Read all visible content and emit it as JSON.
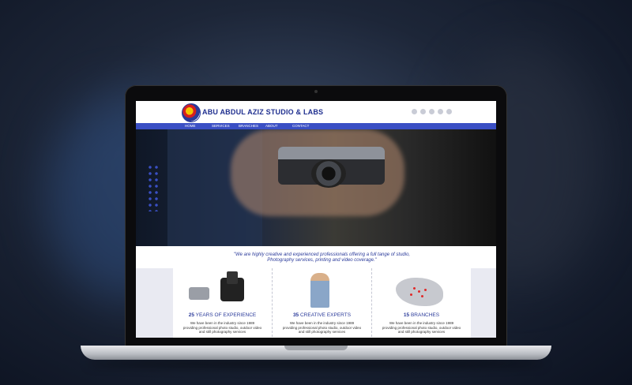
{
  "site": {
    "brand": "ABU ABDUL AZIZ STUDIO & LABS",
    "nav": [
      "HOME",
      "SERVICES",
      "BRANCHES",
      "ABOUT",
      "CONTACT"
    ],
    "quote": "\"We are highly creative and experienced professionals offering a full tange of studio, Photography services, printing and video coverage.\"",
    "features": [
      {
        "num": "25",
        "label": "YEARS OF EXPERIENCE",
        "desc": "We have been in the industry since 1989 providing professional photo studio, outdoor video and still photography services"
      },
      {
        "num": "35",
        "label": "CREATIVE EXPERTS",
        "desc": "We have been in the industry since 1989 providing professional photo studio, outdoor video and still photography services"
      },
      {
        "num": "15",
        "label": "BRANCHES",
        "desc": "We have been in the industry since 1989 providing professional photo studio, outdoor video and still photography services"
      }
    ],
    "icons": {
      "logo": "studio-logo",
      "social": [
        "social-icon",
        "social-icon",
        "social-icon",
        "social-icon",
        "social-icon"
      ]
    },
    "colors": {
      "accent": "#3a4fc4",
      "brand_text": "#1f2f8f",
      "pins": "#e02a2a"
    }
  }
}
